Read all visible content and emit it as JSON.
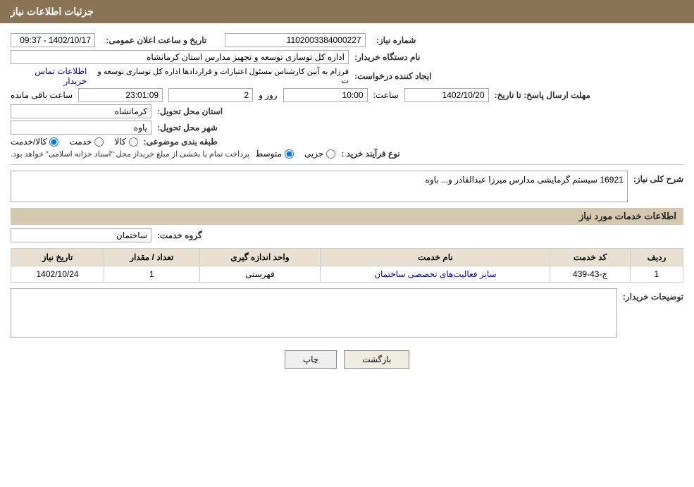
{
  "page": {
    "title": "جزئیات اطلاعات نیاز",
    "header": {
      "label": "جزئیات اطلاعات نیاز"
    }
  },
  "fields": {
    "need_number_label": "شماره نیاز:",
    "need_number_value": "1102003384000227",
    "announce_label": "تاریخ و ساعت اعلان عمومی:",
    "announce_value": "1402/10/17 - 09:37",
    "buyer_org_label": "نام دستگاه خریدار:",
    "buyer_org_value": "اداره کل توسازی  توسعه و تجهیز مدارس استان کرمانشاه",
    "creator_label": "ایجاد کننده درخواست:",
    "creator_value": "فرزام به آیین کارشناس مسئول اعتبارات و قراردادها اداره کل توسازی  توسعه و ت",
    "creator_link": "اطلاعات تماس خریدار",
    "deadline_label": "مهلت ارسال پاسخ: تا تاریخ:",
    "deadline_date": "1402/10/20",
    "deadline_time_label": "ساعت:",
    "deadline_time": "10:00",
    "deadline_days_label": "روز و",
    "deadline_days": "2",
    "deadline_remaining_label": "ساعت باقی مانده",
    "deadline_remaining": "23:01:09",
    "province_label": "استان محل تحویل:",
    "province_value": "کرمانشاه",
    "city_label": "شهر محل تحویل:",
    "city_value": "پاوه",
    "category_label": "طبقه بندی موضوعی:",
    "category_options": [
      "کالا",
      "خدمت",
      "کالا/خدمت"
    ],
    "category_selected": "کالا",
    "purchase_type_label": "نوع فرآیند خرید :",
    "purchase_options": [
      "جزیی",
      "متوسط"
    ],
    "purchase_note": "پرداخت تمام یا بخشی از مبلغ خریداز محل \"اسناد خزانه اسلامی\" خواهد بود.",
    "description_label": "شرح کلی نیاز:",
    "description_value": "16921 سیستم گرمایشی مدارس میرزا عبدالقادر و... باوه",
    "services_section_label": "اطلاعات خدمات مورد نیاز",
    "service_group_label": "گروه خدمت:",
    "service_group_value": "ساختمان",
    "table": {
      "columns": [
        "ردیف",
        "کد خدمت",
        "نام خدمت",
        "واحد اندازه گیری",
        "تعداد / مقدار",
        "تاریخ نیاز"
      ],
      "rows": [
        {
          "row": "1",
          "code": "ج-43-439",
          "name": "سایر فعالیت‌های تخصصی ساختمان",
          "unit": "فهرستی",
          "quantity": "1",
          "date": "1402/10/24"
        }
      ]
    },
    "buyer_notes_label": "توضیحات خریدار:",
    "buyer_notes_value": ""
  },
  "buttons": {
    "back_label": "بازگشت",
    "print_label": "چاپ"
  }
}
